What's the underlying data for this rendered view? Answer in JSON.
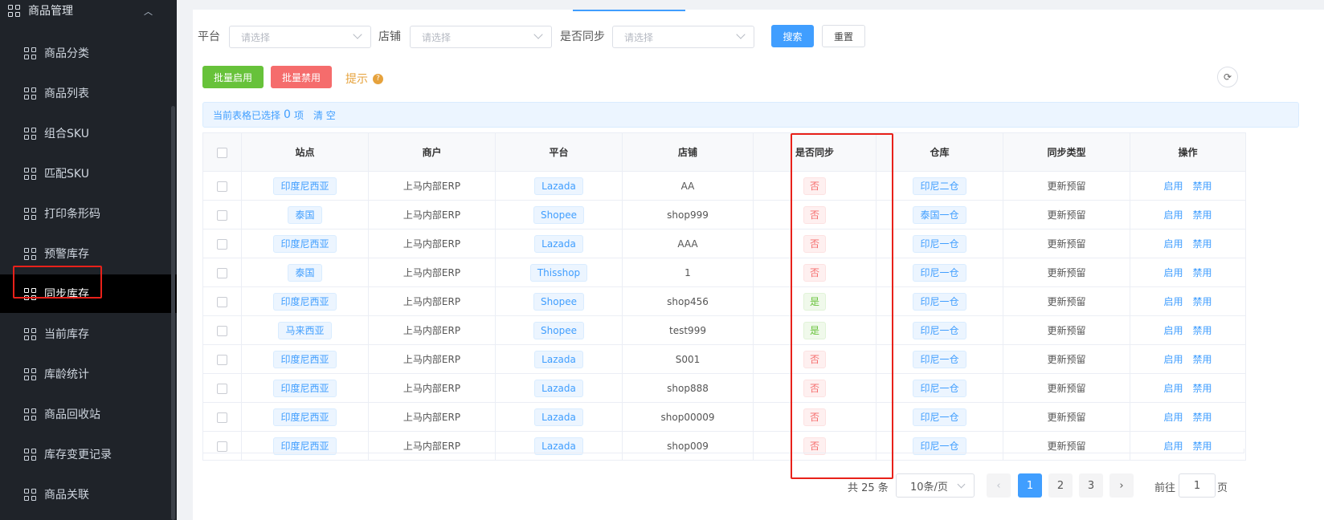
{
  "sidebar": {
    "group_label": "商品管理",
    "items": [
      {
        "label": "商品分类"
      },
      {
        "label": "商品列表"
      },
      {
        "label": "组合SKU"
      },
      {
        "label": "匹配SKU"
      },
      {
        "label": "打印条形码"
      },
      {
        "label": "预警库存"
      },
      {
        "label": "同步库存",
        "active": true
      },
      {
        "label": "当前库存"
      },
      {
        "label": "库龄统计"
      },
      {
        "label": "商品回收站"
      },
      {
        "label": "库存变更记录"
      },
      {
        "label": "商品关联"
      }
    ]
  },
  "filters": {
    "platform_label": "平台",
    "platform_placeholder": "请选择",
    "shop_label": "店铺",
    "shop_placeholder": "请选择",
    "sync_label": "是否同步",
    "sync_placeholder": "请选择",
    "search_btn": "搜索",
    "reset_btn": "重置"
  },
  "toolbar": {
    "batch_enable": "批量启用",
    "batch_disable": "批量禁用",
    "tip": "提示",
    "tip_icon": "?",
    "refresh_icon": "⟳"
  },
  "selection_alert": {
    "prefix": "当前表格已选择",
    "count": "0",
    "suffix": "项",
    "clear": "清 空"
  },
  "table": {
    "columns": [
      "站点",
      "商户",
      "平台",
      "店铺",
      "是否同步",
      "仓库",
      "同步类型",
      "操作"
    ],
    "rows": [
      {
        "site": "印度尼西亚",
        "merchant": "上马内部ERP",
        "platform": "Lazada",
        "shop": "AA",
        "sync": "否",
        "warehouse": "印尼二仓",
        "sync_type": "更新预留",
        "enable": "启用",
        "disable": "禁用"
      },
      {
        "site": "泰国",
        "merchant": "上马内部ERP",
        "platform": "Shopee",
        "shop": "shop999",
        "sync": "否",
        "warehouse": "泰国一仓",
        "sync_type": "更新预留",
        "enable": "启用",
        "disable": "禁用"
      },
      {
        "site": "印度尼西亚",
        "merchant": "上马内部ERP",
        "platform": "Lazada",
        "shop": "AAA",
        "sync": "否",
        "warehouse": "印尼一仓",
        "sync_type": "更新预留",
        "enable": "启用",
        "disable": "禁用"
      },
      {
        "site": "泰国",
        "merchant": "上马内部ERP",
        "platform": "Thisshop",
        "shop": "1",
        "sync": "否",
        "warehouse": "印尼一仓",
        "sync_type": "更新预留",
        "enable": "启用",
        "disable": "禁用"
      },
      {
        "site": "印度尼西亚",
        "merchant": "上马内部ERP",
        "platform": "Shopee",
        "shop": "shop456",
        "sync": "是",
        "warehouse": "印尼一仓",
        "sync_type": "更新预留",
        "enable": "启用",
        "disable": "禁用"
      },
      {
        "site": "马来西亚",
        "merchant": "上马内部ERP",
        "platform": "Shopee",
        "shop": "test999",
        "sync": "是",
        "warehouse": "印尼一仓",
        "sync_type": "更新预留",
        "enable": "启用",
        "disable": "禁用"
      },
      {
        "site": "印度尼西亚",
        "merchant": "上马内部ERP",
        "platform": "Lazada",
        "shop": "S001",
        "sync": "否",
        "warehouse": "印尼一仓",
        "sync_type": "更新预留",
        "enable": "启用",
        "disable": "禁用"
      },
      {
        "site": "印度尼西亚",
        "merchant": "上马内部ERP",
        "platform": "Lazada",
        "shop": "shop888",
        "sync": "否",
        "warehouse": "印尼一仓",
        "sync_type": "更新预留",
        "enable": "启用",
        "disable": "禁用"
      },
      {
        "site": "印度尼西亚",
        "merchant": "上马内部ERP",
        "platform": "Lazada",
        "shop": "shop00009",
        "sync": "否",
        "warehouse": "印尼一仓",
        "sync_type": "更新预留",
        "enable": "启用",
        "disable": "禁用"
      },
      {
        "site": "印度尼西亚",
        "merchant": "上马内部ERP",
        "platform": "Lazada",
        "shop": "shop009",
        "sync": "否",
        "warehouse": "印尼一仓",
        "sync_type": "更新预留",
        "enable": "启用",
        "disable": "禁用"
      }
    ]
  },
  "pagination": {
    "total": "共 25 条",
    "page_size": "10条/页",
    "prev_icon": "‹",
    "pages": [
      "1",
      "2",
      "3"
    ],
    "current": "1",
    "next_icon": "›",
    "goto_label": "前往",
    "goto_value": "1",
    "goto_suffix": "页"
  },
  "colors": {
    "accent": "#409eff",
    "success": "#67c23a",
    "danger": "#f56c6c",
    "warning": "#e6a23c",
    "highlight": "#e8211a",
    "sidebar_bg": "#1f2329"
  }
}
